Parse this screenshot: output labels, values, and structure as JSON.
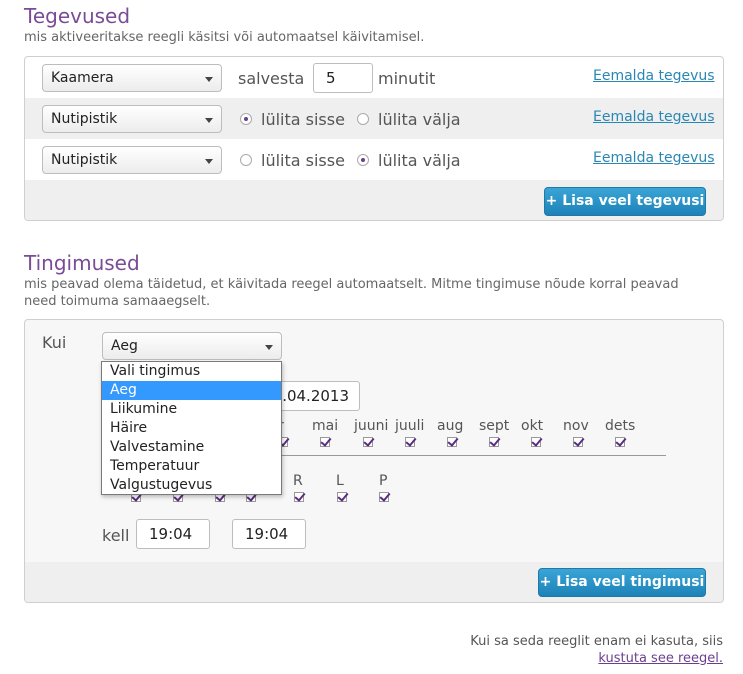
{
  "actions": {
    "title": "Tegevused",
    "subtitle": "mis aktiveeritakse reegli käsitsi või automaatsel käivitamisel.",
    "rows": [
      {
        "device": "Kaamera",
        "save_label": "salvesta",
        "minutes_value": "5",
        "minutes_unit": "minutit",
        "remove_label": "Eemalda tegevus"
      },
      {
        "device": "Nutipistik",
        "on_label": "lülita sisse",
        "off_label": "lülita välja",
        "selected": "on",
        "remove_label": "Eemalda tegevus"
      },
      {
        "device": "Nutipistik",
        "on_label": "lülita sisse",
        "off_label": "lülita välja",
        "selected": "off",
        "remove_label": "Eemalda tegevus"
      }
    ],
    "add_button": "+ Lisa veel tegevusi"
  },
  "conditions": {
    "title": "Tingimused",
    "subtitle_line1": "mis peavad olema täidetud, et käivitada reegel automaatselt. Mitme tingimuse nõude korral peavad",
    "subtitle_line2": "need toimuma samaaegselt.",
    "when_label": "Kui",
    "type_select": "Aeg",
    "dropdown_options": [
      "Vali tingimus",
      "Aeg",
      "Liikumine",
      "Häire",
      "Valvestamine",
      "Temperatuur",
      "Valgustugevus"
    ],
    "dropdown_selected": "Aeg",
    "date_value": "2.04.2013",
    "months_visible": [
      "r",
      "mai",
      "juuni",
      "juuli",
      "aug",
      "sept",
      "okt",
      "nov",
      "dets"
    ],
    "weekdays_visible": [
      "R",
      "L",
      "P"
    ],
    "time_label": "kell",
    "time_from": "19:04",
    "time_to": "19:04",
    "add_button": "+ Lisa veel tingimusi"
  },
  "footer": {
    "note": "Kui sa seda reeglit enam ei kasuta, siis",
    "delete_link": "kustuta see reegel."
  }
}
